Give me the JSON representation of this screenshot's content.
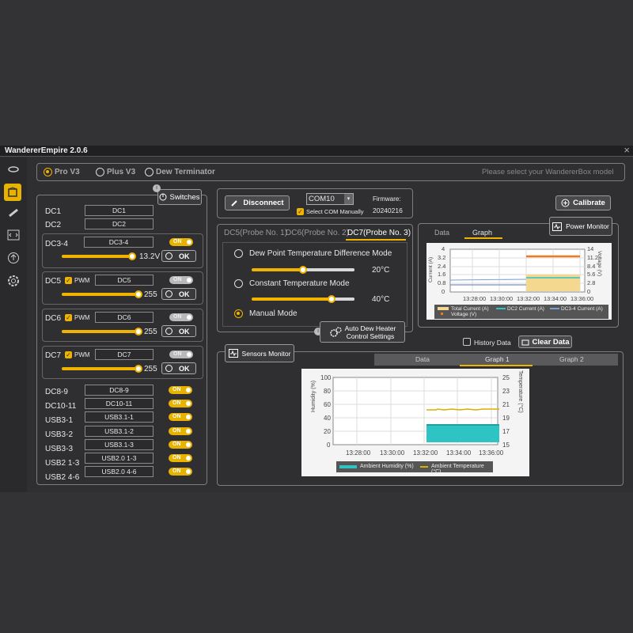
{
  "window": {
    "title": "WandererEmpire 2.0.6",
    "close": "×"
  },
  "device": {
    "options": [
      "Pro V3",
      "Plus V3",
      "Dew Terminator"
    ],
    "hint": "Please select your WandererBox model"
  },
  "switches": {
    "title": "Switches",
    "dc1": "DC1",
    "dc2": "DC2",
    "dc34": "DC3-4",
    "dc34_volt": "13.2V",
    "pwm": "PWM",
    "dc5": "DC5",
    "dc6": "DC6",
    "dc7": "DC7",
    "pwm_val": "255",
    "ok": "OK",
    "on": "ON",
    "dc89": "DC8-9",
    "dc1011": "DC10-11",
    "usb31_1": "USB3-1",
    "usb31_2": "USB3-2",
    "usb31_3": "USB3-3",
    "usb2_13": "USB2 1-3",
    "usb2_46": "USB2 4-6",
    "usb31_1b": "USB3.1-1",
    "usb31_2b": "USB3.1-2",
    "usb31_3b": "USB3.1-3",
    "usb20_13": "USB2.0 1-3",
    "usb20_46": "USB2.0 4-6"
  },
  "connection": {
    "disconnect": "Disconnect",
    "com": "COM10",
    "manual": "Select COM Manually",
    "fw_label": "Firmware:",
    "fw_value": "20240216"
  },
  "dew": {
    "tabs": [
      "DC5(Probe No. 1)",
      "DC6(Probe No. 2)",
      "DC7(Probe No. 3)"
    ],
    "mode1": "Dew Point Temperature Difference Mode",
    "mode1_val": "20°C",
    "mode2": "Constant Temperature Mode",
    "mode2_val": "40°C",
    "mode3": "Manual Mode",
    "auto1": "Auto Dew Heater",
    "auto2": "Control Settings",
    "slider1": 0.5,
    "slider2": 0.78
  },
  "power": {
    "calibrate": "Calibrate",
    "monitor": "Power Monitor",
    "tab_data": "Data",
    "tab_graph": "Graph",
    "left_ticks": [
      "4",
      "3.2",
      "2.4",
      "1.6",
      "0.8",
      "0"
    ],
    "right_ticks": [
      "14",
      "11.2",
      "8.4",
      "5.6",
      "2.8",
      "0"
    ],
    "left_label": "Current (A)",
    "right_label": "Voltage (V)",
    "x_ticks": [
      "13:28:00",
      "13:30:00",
      "13:32:00",
      "13:34:00",
      "13:36:00"
    ],
    "legend": [
      "Total Current (A)",
      "DC2 Current (A)",
      "DC3-4 Current (A)",
      "Voltage (V)"
    ]
  },
  "history": {
    "label": "History Data",
    "clear": "Clear Data"
  },
  "sensors": {
    "title": "Sensors Monitor",
    "tabs": [
      "Data",
      "Graph 1",
      "Graph 2"
    ],
    "left_label": "Humidity (%)",
    "right_label": "Temperature (°C)",
    "left_ticks": [
      "100",
      "80",
      "60",
      "40",
      "20",
      "0"
    ],
    "right_ticks": [
      "25",
      "23",
      "21",
      "19",
      "17",
      "15"
    ],
    "x_ticks": [
      "13:28:00",
      "13:30:00",
      "13:32:00",
      "13:34:00",
      "13:36:00"
    ],
    "legend": [
      "Ambient Humidity (%)",
      "Ambient Temperature (°C)"
    ]
  },
  "colors": {
    "accent": "#f0b400",
    "teal": "#2ec4c4",
    "orange": "#f07a20"
  }
}
